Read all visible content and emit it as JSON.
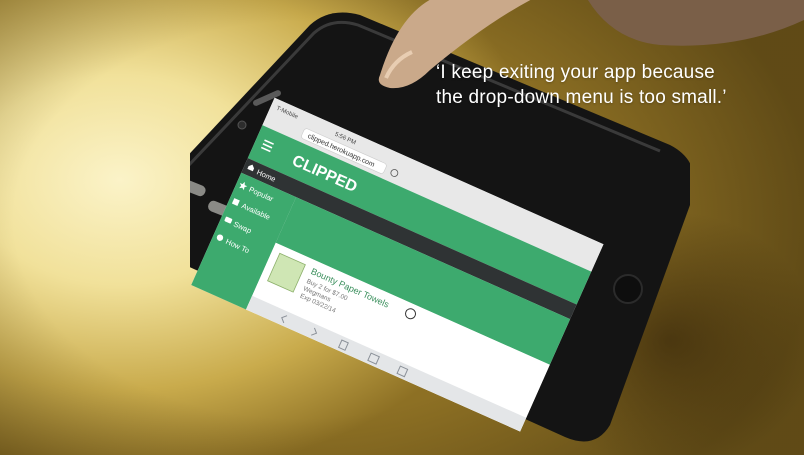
{
  "caption": {
    "line1": "‘I keep exiting your app because",
    "line2": "the drop-down menu is too small.’"
  },
  "phone_screen": {
    "carrier": "T-Mobile",
    "time": "5:56 PM",
    "url": "clipped.herokuapp.com",
    "brand": "CLIPPED",
    "menu_items": [
      "Home",
      "Popular",
      "Available",
      "Swap",
      "How To"
    ],
    "deal": {
      "title": "Bounty Paper Towels",
      "offer": "Buy 2 for $7.00",
      "store": "Wegmans",
      "expires": "Exp 03/22/14"
    }
  },
  "colors": {
    "app_green": "#3daa6e",
    "nav_dark": "#2f3334",
    "phone_body": "#141414"
  },
  "icons": [
    "hamburger-icon",
    "home-icon",
    "star-icon",
    "list-icon",
    "camera-icon",
    "info-icon",
    "back-icon",
    "forward-icon",
    "share-icon",
    "bookmarks-icon",
    "tabs-icon",
    "reload-icon",
    "checkmark-icon"
  ]
}
